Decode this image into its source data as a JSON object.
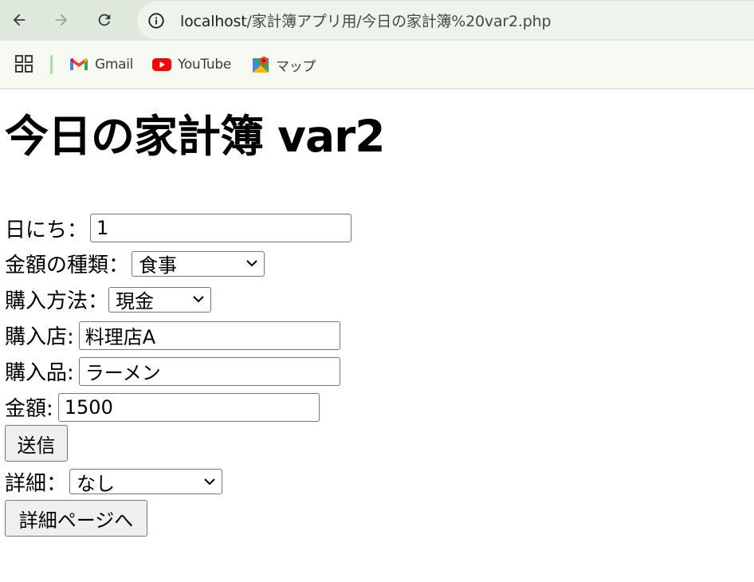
{
  "browser": {
    "url_host": "localhost",
    "url_path": "/家計簿アプリ用/今日の家計簿%20var2.php",
    "bookmarks": [
      {
        "label": "Gmail",
        "icon": "gmail-icon"
      },
      {
        "label": "YouTube",
        "icon": "youtube-icon"
      },
      {
        "label": "マップ",
        "icon": "maps-icon"
      }
    ]
  },
  "page": {
    "title": "今日の家計簿 var2",
    "form": {
      "date_label": "日にち：",
      "date_value": "1",
      "type_label": "金額の種類：",
      "type_value": "食事",
      "method_label": "購入方法：",
      "method_value": "現金",
      "store_label": "購入店:",
      "store_value": "料理店A",
      "item_label": "購入品:",
      "item_value": "ラーメン",
      "amount_label": "金額:",
      "amount_value": "1500",
      "submit_label": "送信",
      "detail_label": "詳細：",
      "detail_value": "なし",
      "detail_button_label": "詳細ページへ"
    }
  },
  "colors": {
    "toolbar_bg": "#dfe8dc",
    "omnibox_bg": "#eef4ec",
    "bookmarks_bg": "#f6faf3",
    "button_bg": "#efefef"
  }
}
